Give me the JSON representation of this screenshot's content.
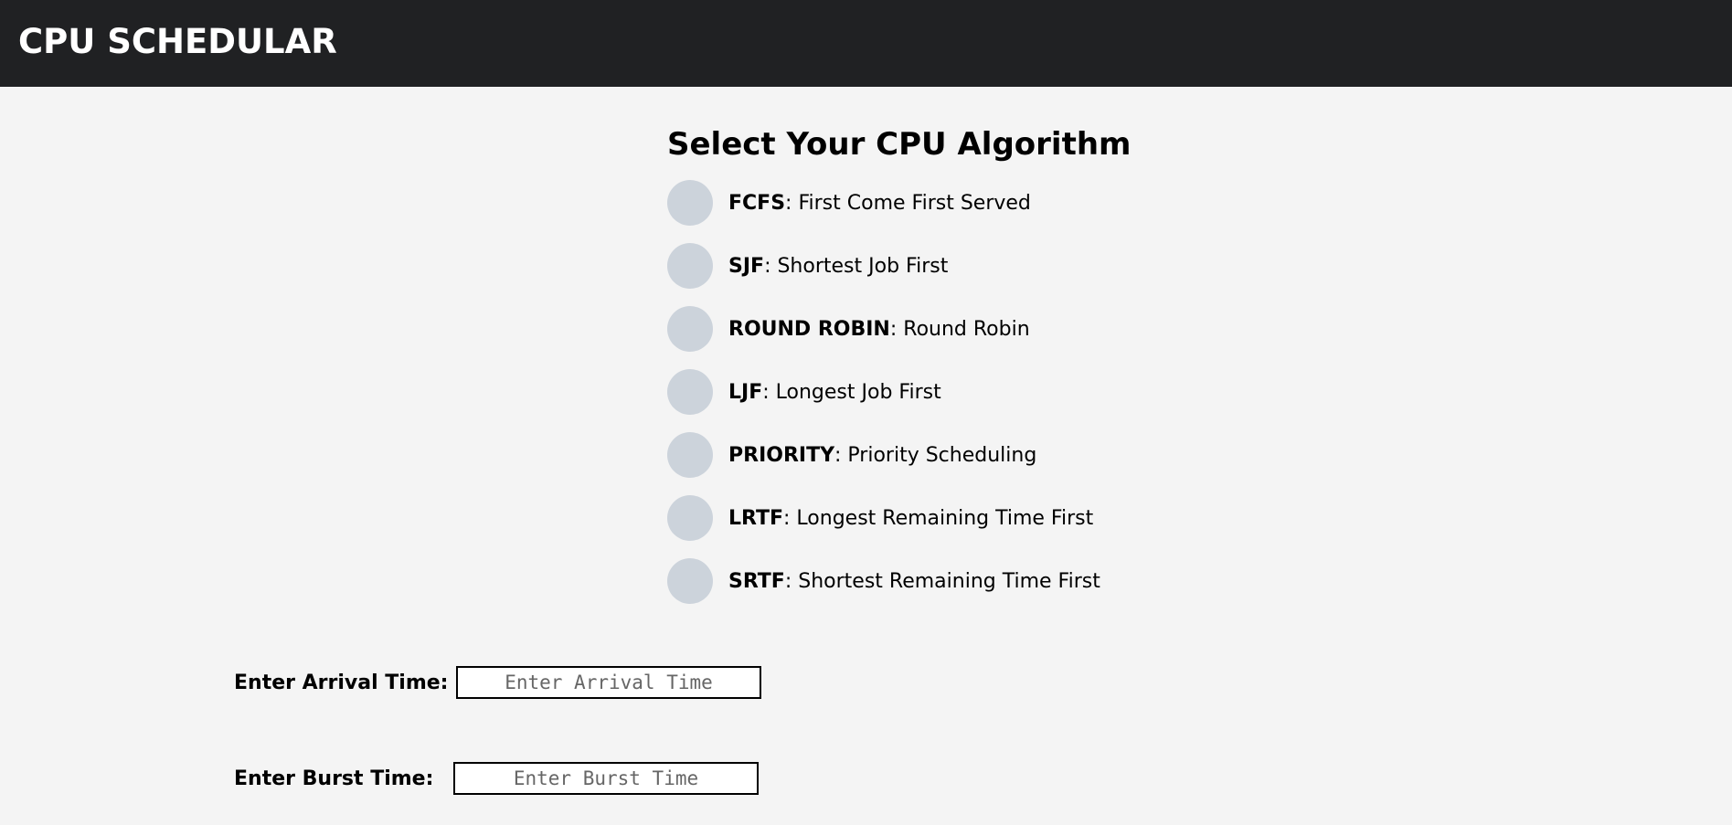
{
  "header": {
    "title": "CPU SCHEDULAR"
  },
  "algorithms": {
    "heading": "Select Your CPU Algorithm",
    "options": [
      {
        "code": "FCFS",
        "description": ": First Come First Served"
      },
      {
        "code": "SJF",
        "description": ": Shortest Job First"
      },
      {
        "code": "ROUND ROBIN",
        "description": ": Round Robin"
      },
      {
        "code": "LJF",
        "description": ": Longest Job First"
      },
      {
        "code": "PRIORITY",
        "description": ": Priority Scheduling"
      },
      {
        "code": "LRTF",
        "description": ": Longest Remaining Time First"
      },
      {
        "code": "SRTF",
        "description": ": Shortest Remaining Time First"
      }
    ]
  },
  "form": {
    "arrival": {
      "label": "Enter Arrival Time:",
      "value": "",
      "placeholder": "Enter Arrival Time"
    },
    "burst": {
      "label": "Enter Burst Time:",
      "value": "",
      "placeholder": "Enter Burst Time"
    }
  },
  "colors": {
    "header_bg": "#202123",
    "page_bg": "#f4f4f4",
    "radio_fill": "#ccd3db"
  }
}
